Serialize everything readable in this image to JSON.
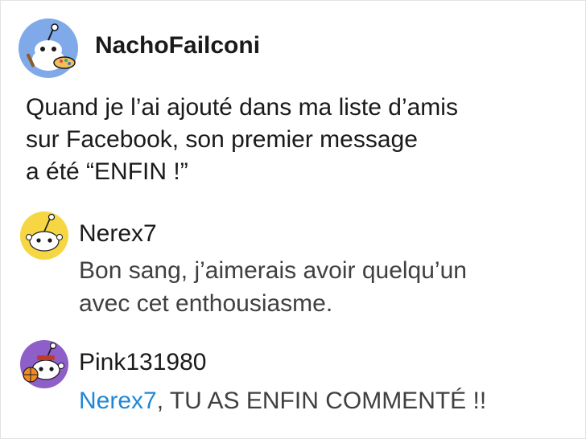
{
  "post": {
    "author": "NachoFailconi",
    "avatar_icon": "snoo-painter-avatar-icon",
    "body_lines": [
      "Quand je l’ai ajouté dans ma liste d’amis",
      "sur Facebook, son premier message",
      "a été “ENFIN !”"
    ]
  },
  "comments": [
    {
      "author": "Nerex7",
      "avatar_icon": "snoo-yellow-avatar-icon",
      "body_lines": [
        "Bon sang, j’aimerais avoir quelqu’un",
        "avec cet enthousiasme."
      ]
    },
    {
      "author": "Pink131980",
      "avatar_icon": "snoo-purple-basketball-avatar-icon",
      "mention": "Nerex7",
      "body_rest": ", TU AS ENFIN COMMENTÉ !!"
    }
  ],
  "colors": {
    "mention": "#1e88d6",
    "op_avatar_bg": "#7fa9e8",
    "c1_avatar_bg": "#f6d743",
    "c2_avatar_bg": "#8f5fc9"
  }
}
